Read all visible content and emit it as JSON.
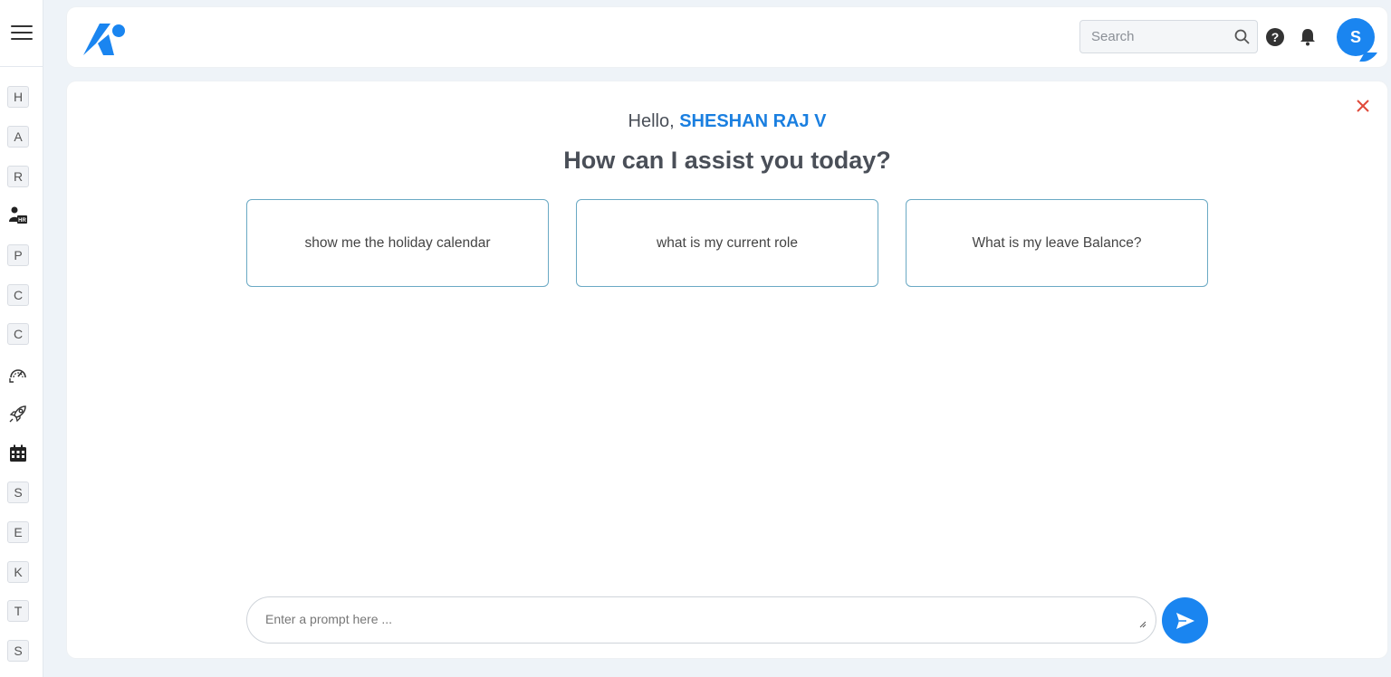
{
  "sidebar": {
    "items": [
      {
        "type": "letter",
        "label": "H"
      },
      {
        "type": "letter",
        "label": "A"
      },
      {
        "type": "letter",
        "label": "R"
      },
      {
        "type": "icon",
        "icon": "hr-person-icon"
      },
      {
        "type": "letter",
        "label": "P"
      },
      {
        "type": "letter",
        "label": "C"
      },
      {
        "type": "letter",
        "label": "C"
      },
      {
        "type": "icon",
        "icon": "gauge-icon"
      },
      {
        "type": "icon",
        "icon": "rocket-icon"
      },
      {
        "type": "icon",
        "icon": "calendar-icon"
      },
      {
        "type": "letter",
        "label": "S"
      },
      {
        "type": "letter",
        "label": "E"
      },
      {
        "type": "letter",
        "label": "K"
      },
      {
        "type": "letter",
        "label": "T"
      },
      {
        "type": "letter",
        "label": "S"
      }
    ]
  },
  "header": {
    "search_placeholder": "Search",
    "avatar_initial": "S"
  },
  "main": {
    "greeting_prefix": "Hello, ",
    "user_name": "SHESHAN RAJ V",
    "headline": "How can I assist you today?",
    "suggestions": [
      "show me the holiday calendar",
      "what is my current role",
      "What is my leave Balance?"
    ],
    "prompt_placeholder": "Enter a prompt here ..."
  },
  "colors": {
    "accent": "#1a85f0",
    "close": "#e04a3a",
    "suggestion_border": "#6aa9c4"
  }
}
